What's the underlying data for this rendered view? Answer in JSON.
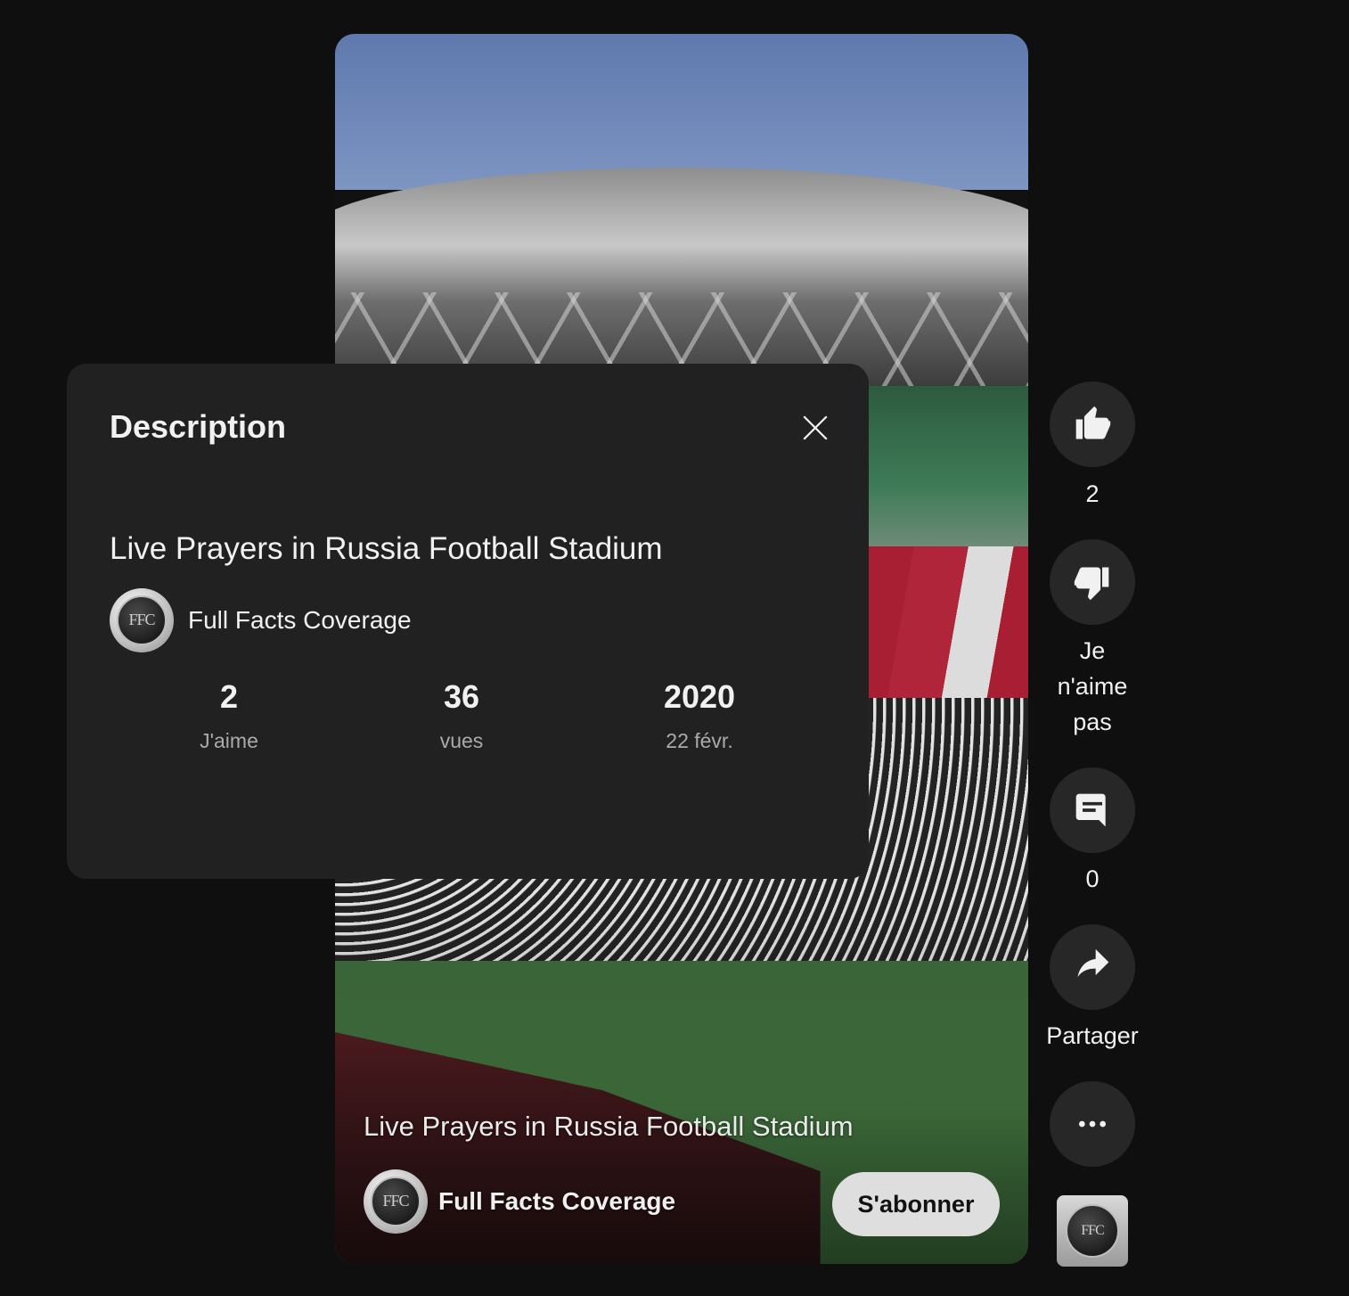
{
  "video": {
    "overlay_title": "Live Prayers in Russia Football Stadium",
    "channel_name": "Full Facts Coverage",
    "avatar_monogram": "FFC",
    "subscribe_label": "S'abonner"
  },
  "actions": {
    "like_count": "2",
    "dislike_label": "Je n'aime pas",
    "comment_count": "0",
    "share_label": "Partager"
  },
  "description_panel": {
    "heading": "Description",
    "video_title": "Live Prayers in Russia Football Stadium",
    "channel_name": "Full Facts Coverage",
    "stats": [
      {
        "value": "2",
        "label": "J'aime"
      },
      {
        "value": "36",
        "label": "vues"
      },
      {
        "value": "2020",
        "label": "22 févr."
      }
    ]
  },
  "icons": {
    "like": "thumbs-up-icon",
    "dislike": "thumbs-down-icon",
    "comment": "comment-icon",
    "share": "share-arrow-icon",
    "more": "more-horizontal-icon",
    "close": "close-icon"
  },
  "colors": {
    "background": "#0f0f0f",
    "panel": "#212121",
    "rail_button": "#272727",
    "subscribe_button": "#dedede",
    "secondary_text": "#aaaaaa"
  }
}
